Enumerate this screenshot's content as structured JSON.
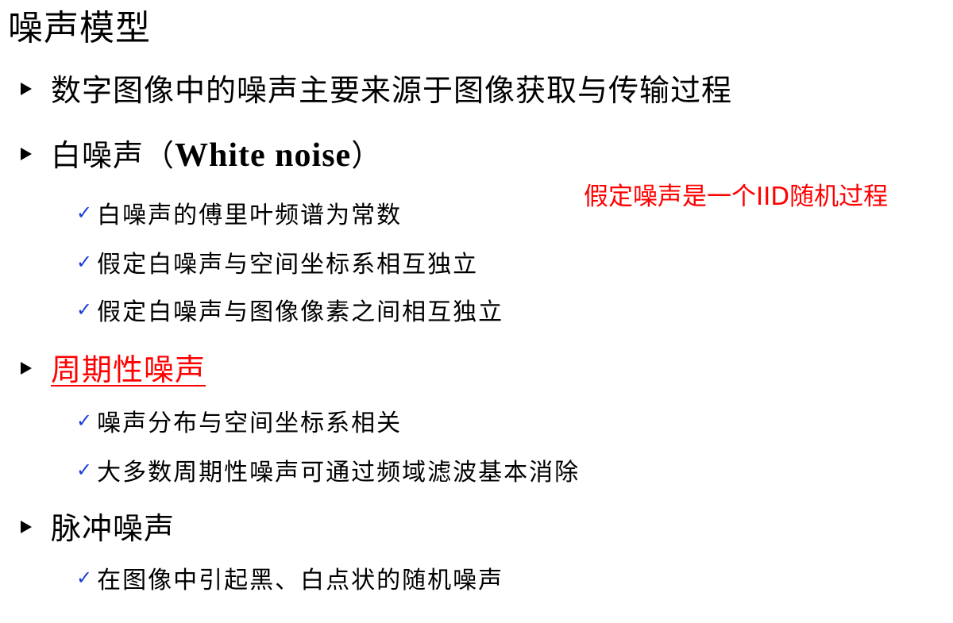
{
  "title": "噪声模型",
  "bullets": [
    {
      "text": "数字图像中的噪声主要来源于图像获取与传输过程"
    },
    {
      "text_prefix": "白噪声（",
      "text_latin": "White noise",
      "text_suffix": "）"
    },
    {
      "text": "周期性噪声"
    },
    {
      "text": "脉冲噪声"
    }
  ],
  "white_noise_items": [
    "白噪声的傅里叶频谱为常数",
    "假定白噪声与空间坐标系相互独立",
    "假定白噪声与图像像素之间相互独立"
  ],
  "periodic_noise_items": [
    "噪声分布与空间坐标系相关",
    "大多数周期性噪声可通过频域滤波基本消除"
  ],
  "impulse_noise_items": [
    "在图像中引起黑、白点状的随机噪声"
  ],
  "note": "假定噪声是一个IID随机过程",
  "colors": {
    "text": "#000000",
    "highlight": "#ff0000",
    "checkmark": "#1a3fd6",
    "background": "#ffffff"
  },
  "icons": {
    "bullet": "triangle-bullet-icon",
    "sub_bullet": "checkmark-icon"
  }
}
